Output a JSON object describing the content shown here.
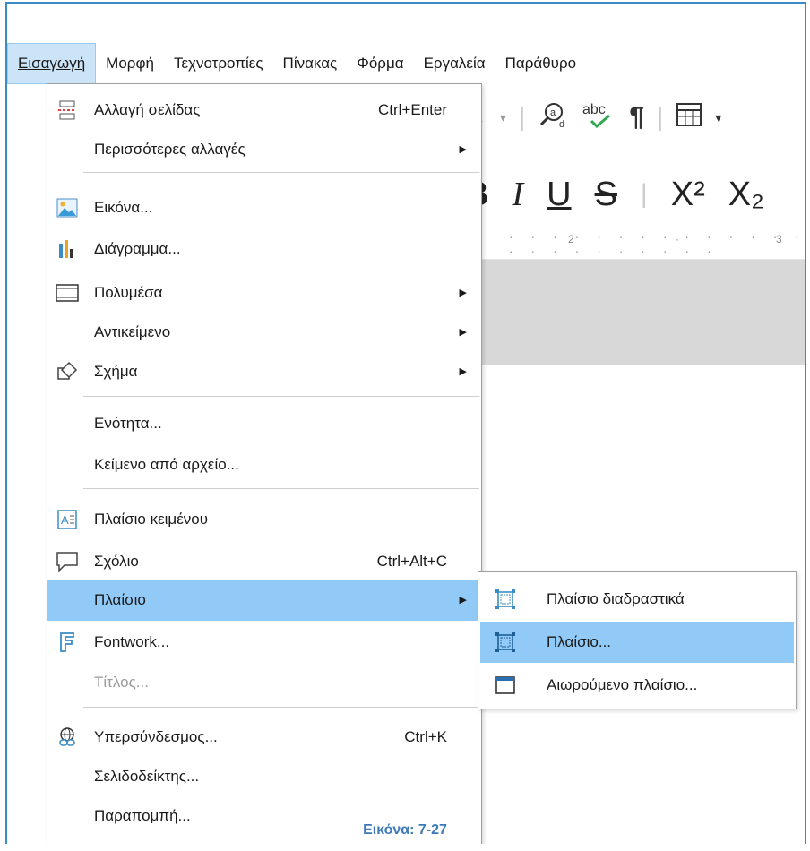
{
  "menubar": {
    "items": [
      "Εισαγωγή",
      "Μορφή",
      "Τεχνοτροπίες",
      "Πίνακας",
      "Φόρμα",
      "Εργαλεία",
      "Παράθυρο"
    ]
  },
  "toolbar": {
    "redo_icon": "redo-arrow-icon",
    "find_replace_icon": "find-replace-icon",
    "spelling_icon": "spelling-icon",
    "pilcrow_icon": "formatting-marks-icon",
    "table_icon": "insert-table-icon",
    "bold": "B",
    "italic": "I",
    "underline": "U",
    "strikethrough": "S",
    "superscript": "X²",
    "subscript": "X₂"
  },
  "ruler": {
    "mark_2": "2",
    "mark_3": "3"
  },
  "menu": {
    "items": [
      {
        "label": "Αλλαγή σελίδας",
        "shortcut": "Ctrl+Enter",
        "icon": "page-break-icon"
      },
      {
        "label": "Περισσότερες αλλαγές",
        "submenu": true
      },
      {
        "label": "Εικόνα...",
        "icon": "image-icon"
      },
      {
        "label": "Διάγραμμα...",
        "icon": "chart-icon"
      },
      {
        "label": "Πολυμέσα",
        "icon": "media-icon",
        "submenu": true
      },
      {
        "label": "Αντικείμενο",
        "submenu": true
      },
      {
        "label": "Σχήμα",
        "icon": "shape-icon",
        "submenu": true
      },
      {
        "label": "Ενότητα..."
      },
      {
        "label": "Κείμενο από αρχείο..."
      },
      {
        "label": "Πλαίσιο κειμένου",
        "icon": "text-box-icon"
      },
      {
        "label": "Σχόλιο",
        "shortcut": "Ctrl+Alt+C",
        "icon": "comment-icon"
      },
      {
        "label": "Πλαίσιο",
        "submenu": true,
        "highlighted": true
      },
      {
        "label": "Fontwork...",
        "icon": "fontwork-icon"
      },
      {
        "label": "Τίτλος...",
        "disabled": true
      },
      {
        "label": "Υπερσύνδεσμος...",
        "shortcut": "Ctrl+K",
        "icon": "hyperlink-icon"
      },
      {
        "label": "Σελιδοδείκτης..."
      },
      {
        "label": "Παραπομπή..."
      }
    ]
  },
  "submenu": {
    "items": [
      {
        "label": "Πλαίσιο διαδραστικά",
        "icon": "frame-interactive-icon"
      },
      {
        "label": "Πλαίσιο...",
        "icon": "frame-icon",
        "highlighted": true
      },
      {
        "label": "Αιωρούμενο πλαίσιο...",
        "icon": "floating-frame-icon"
      }
    ]
  },
  "caption": "Εικόνα: 7-27",
  "colors": {
    "highlight": "#91c9f7",
    "border_accent": "#3a8dc4",
    "caption": "#3d7ab8"
  }
}
